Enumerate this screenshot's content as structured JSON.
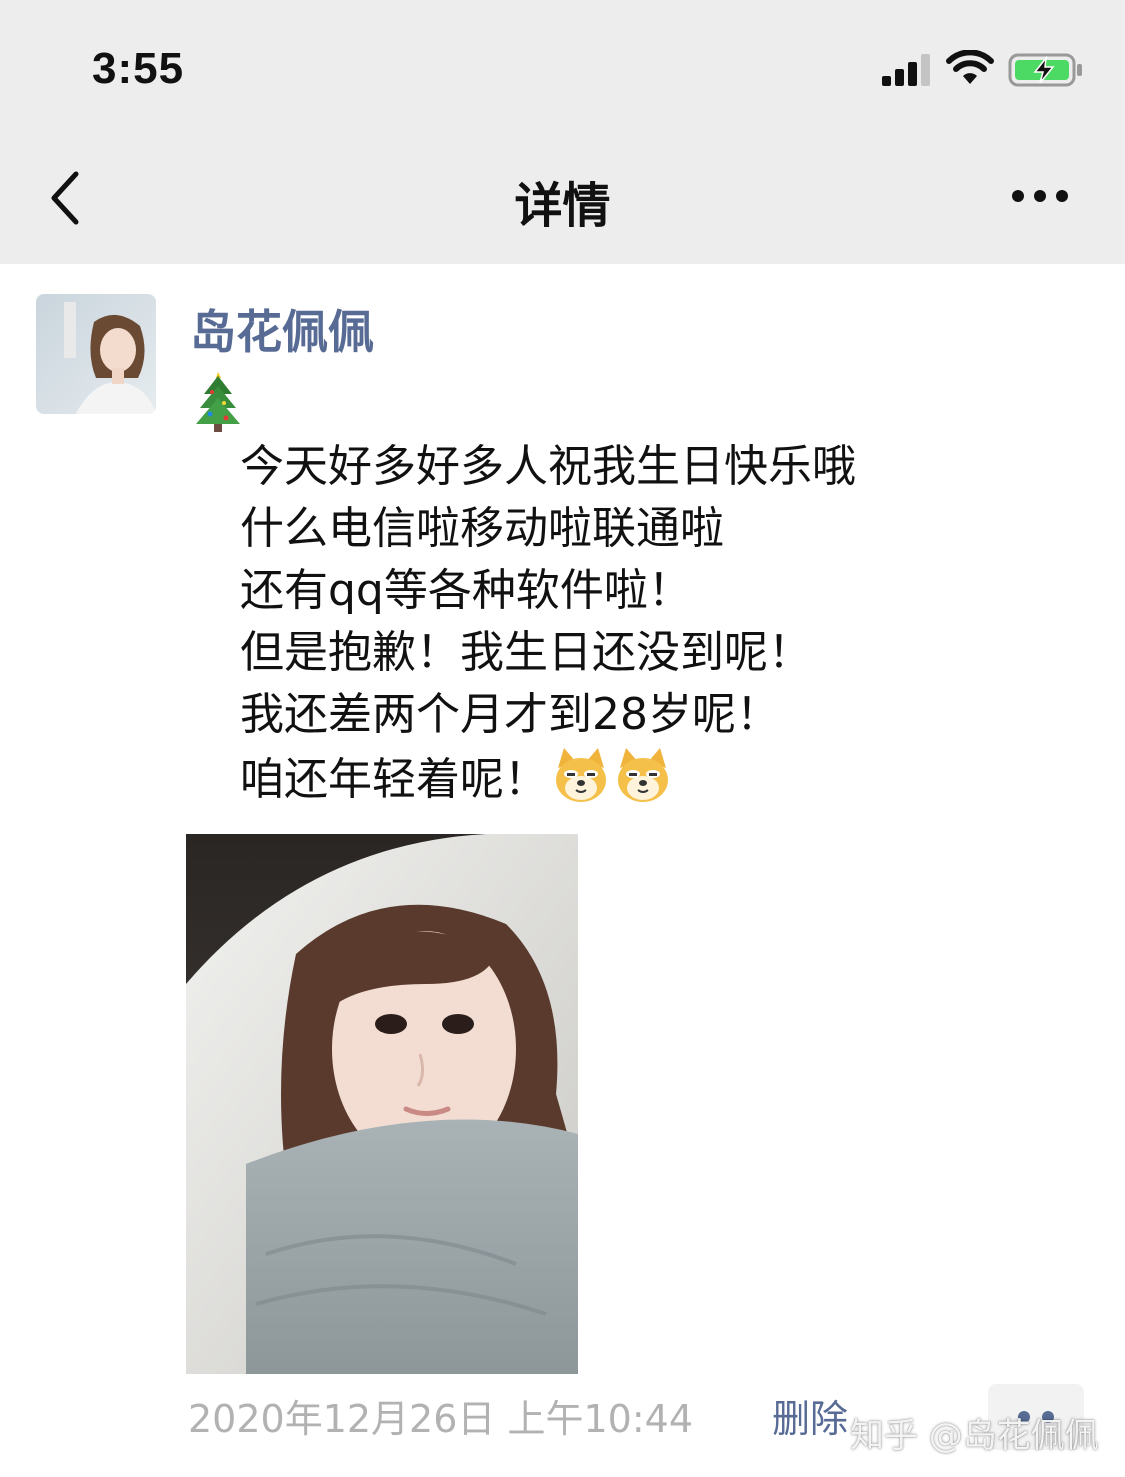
{
  "status_bar": {
    "time": "3:55",
    "signal_icon": "cellular-signal-icon",
    "wifi_icon": "wifi-icon",
    "battery_icon": "battery-charging-icon"
  },
  "nav": {
    "title": "详情",
    "back_icon": "chevron-left-icon",
    "more_icon": "more-horizontal-icon"
  },
  "post": {
    "author": "岛花佩佩",
    "emoji": "christmas-tree-emoji",
    "lines": [
      "今天好多好多人祝我生日快乐哦",
      "什么电信啦移动啦联通啦",
      "还有qq等各种软件啦！",
      "但是抱歉！我生日还没到呢！",
      "我还差两个月才到28岁呢！",
      "咱还年轻着呢！"
    ],
    "trailing_emoji": "doge-emoji",
    "photo": "selfie-photo",
    "timestamp": "2020年12月26日 上午10:44",
    "delete_label": "删除"
  },
  "watermark": "知乎 @岛花佩佩",
  "colors": {
    "nav_bg": "#ededed",
    "link": "#576b95",
    "meta": "#b2b2b2",
    "text": "#111111"
  }
}
